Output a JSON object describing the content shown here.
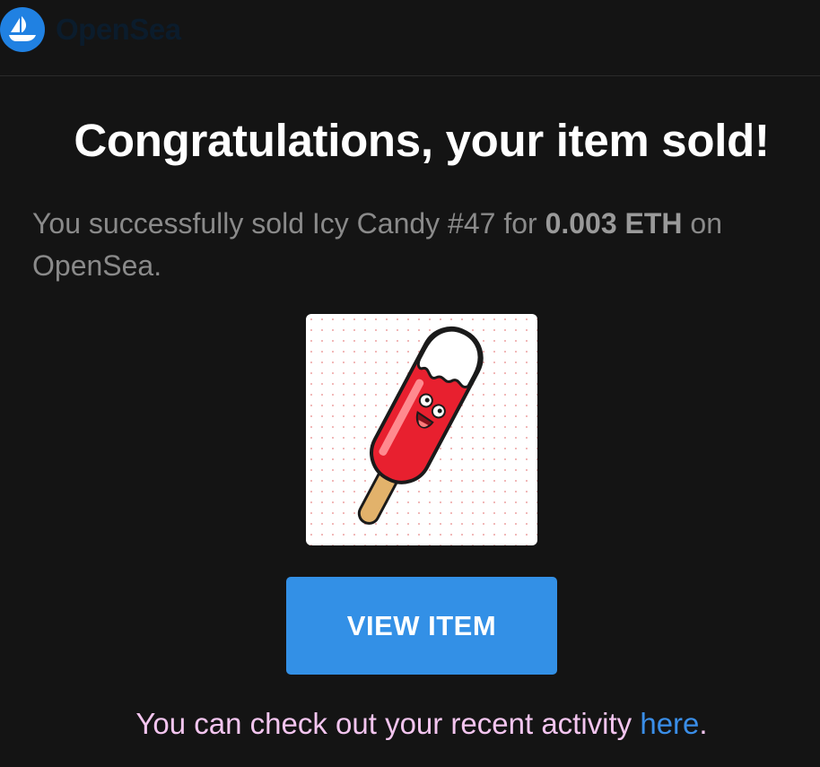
{
  "brand": {
    "name": "OpenSea",
    "color": "#2081e2"
  },
  "email": {
    "title": "Congratulations, your item sold!",
    "message_prefix": "You successfully sold Icy Candy #47 for ",
    "price": "0.003 ETH",
    "message_suffix": " on OpenSea.",
    "image_alt": "Icy Candy #47",
    "button_label": "VIEW ITEM",
    "footer_prefix": "You can check out your recent activity ",
    "footer_link": "here",
    "footer_suffix": "."
  }
}
